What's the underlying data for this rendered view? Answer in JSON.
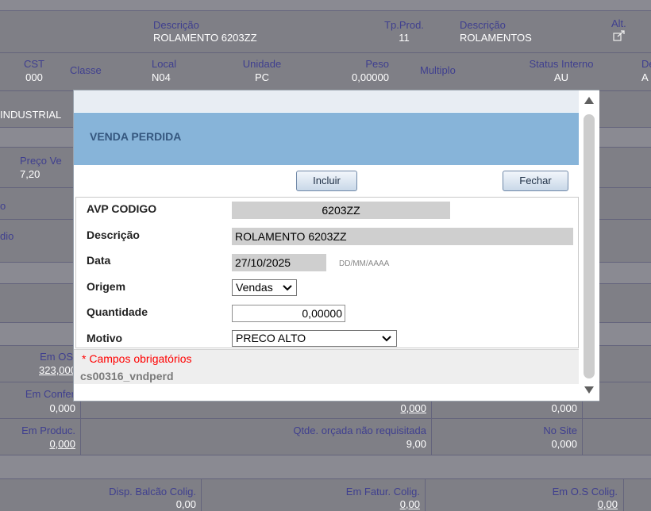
{
  "background": {
    "row1": {
      "descricao_label": "Descrição",
      "descricao_value": "ROLAMENTO 6203ZZ",
      "tpprod_label": "Tp.Prod.",
      "tpprod_value": "11",
      "descricao2_label": "Descrição",
      "descricao2_value": "ROLAMENTOS",
      "alt_label": "Alt."
    },
    "row2": {
      "cst_label": "CST",
      "cst_value": "000",
      "classe_label": "Classe",
      "local_label": "Local",
      "local_value": "N04",
      "unidade_label": "Unidade",
      "unidade_value": "PC",
      "peso_label": "Peso",
      "peso_value": "0,00000",
      "multiplo_label": "Multiplo",
      "status_label": "Status Interno",
      "status_value": "AU",
      "extra_label": "De",
      "extra_value": "A"
    },
    "industrial_text": "INDUSTRIAL",
    "preco_label": "Preço Ve",
    "preco_value": "7,20",
    "left_frag_1": "o",
    "left_frag_2": "dio",
    "em_os_label": "Em OS",
    "em_os_value": "323,000",
    "em_confer_label": "Em Confer",
    "em_confer_value": "0,000",
    "mid_link_value": "0,000",
    "right_value_1": "0,000",
    "em_producao_label": "Em Produc.",
    "em_producao_value": "0,000",
    "qtde_orcada_label": "Qtde. orçada não requisitada",
    "qtde_orcada_value": "9,00",
    "no_site_label": "No Site",
    "no_site_value": "0,000",
    "disp_balcao_label": "Disp. Balcão Colig.",
    "disp_balcao_value": "0,00",
    "em_fatur_label": "Em Fatur. Colig.",
    "em_fatur_value": "0,00",
    "em_os_colig_label": "Em O.S Colig.",
    "em_os_colig_value": "0,00"
  },
  "modal": {
    "title": "VENDA PERDIDA",
    "incluir_label": "Incluir",
    "fechar_label": "Fechar",
    "fields": {
      "avp_codigo_label": "AVP CODIGO",
      "avp_codigo_value": "6203ZZ",
      "descricao_label": "Descrição",
      "descricao_value": "ROLAMENTO 6203ZZ",
      "data_label": "Data",
      "data_value": "27/10/2025",
      "data_format": "DD/MM/AAAA",
      "origem_label": "Origem",
      "origem_value": "Vendas",
      "quantidade_label": "Quantidade",
      "quantidade_value": "0,00000",
      "motivo_label": "Motivo",
      "motivo_value": "PRECO ALTO"
    },
    "required_note": "* Campos obrigatórios",
    "program_id": "cs00316_vndperd"
  },
  "icons": {
    "alt": "external-edit-icon",
    "scroll_up": "triangle-up-icon",
    "scroll_down": "triangle-down-icon",
    "select": "chevron-down-icon"
  },
  "colors": {
    "overlay": "#7f7f86",
    "modal_header": "#87b4d9",
    "required": "#ff0000"
  }
}
